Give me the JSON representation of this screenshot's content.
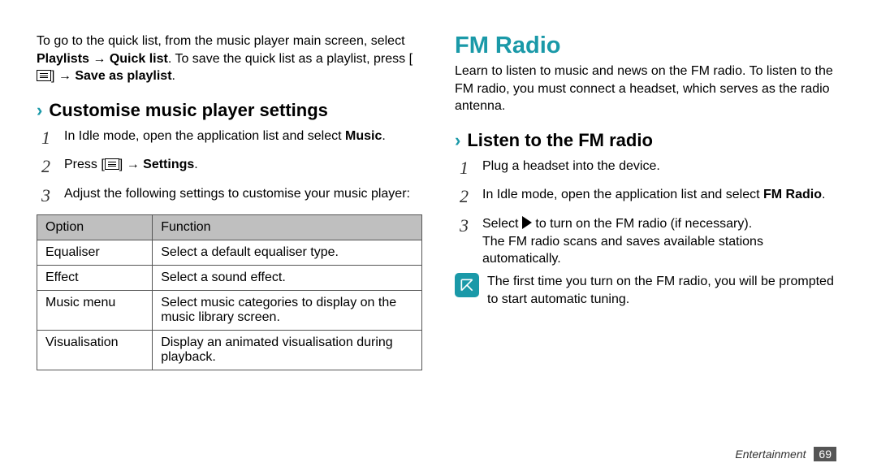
{
  "left": {
    "intro": {
      "text1": "To go to the quick list, from the music player main screen, select ",
      "bold1": "Playlists",
      "arrow1": " → ",
      "bold2": "Quick list",
      "text2": ". To save the quick list as a playlist, press [",
      "text3": "] → ",
      "bold3": "Save as playlist",
      "text4": "."
    },
    "heading": "Customise music player settings",
    "steps": {
      "s1a": "In Idle mode, open the application list and select ",
      "s1b": "Music",
      "s1c": ".",
      "s2a": "Press [",
      "s2b": "] → ",
      "s2c": "Settings",
      "s2d": ".",
      "s3": "Adjust the following settings to customise your music player:"
    },
    "table": {
      "h1": "Option",
      "h2": "Function",
      "r1c1": "Equaliser",
      "r1c2": "Select a default equaliser type.",
      "r2c1": "Effect",
      "r2c2": "Select a sound effect.",
      "r3c1": "Music menu",
      "r3c2": "Select music categories to display on the music library screen.",
      "r4c1": "Visualisation",
      "r4c2": "Display an animated visualisation during playback."
    }
  },
  "right": {
    "title": "FM Radio",
    "intro": "Learn to listen to music and news on the FM radio. To listen to the FM radio, you must connect a headset, which serves as the radio antenna.",
    "heading": "Listen to the FM radio",
    "steps": {
      "s1": "Plug a headset into the device.",
      "s2a": "In Idle mode, open the application list and select ",
      "s2b": "FM Radio",
      "s2c": ".",
      "s3a": "Select ",
      "s3b": " to turn on the FM radio (if necessary).",
      "s3c": "The FM radio scans and saves available stations automatically."
    },
    "note": "The first time you turn on the FM radio, you will be prompted to start automatic tuning."
  },
  "footer": {
    "section": "Entertainment",
    "page": "69"
  }
}
